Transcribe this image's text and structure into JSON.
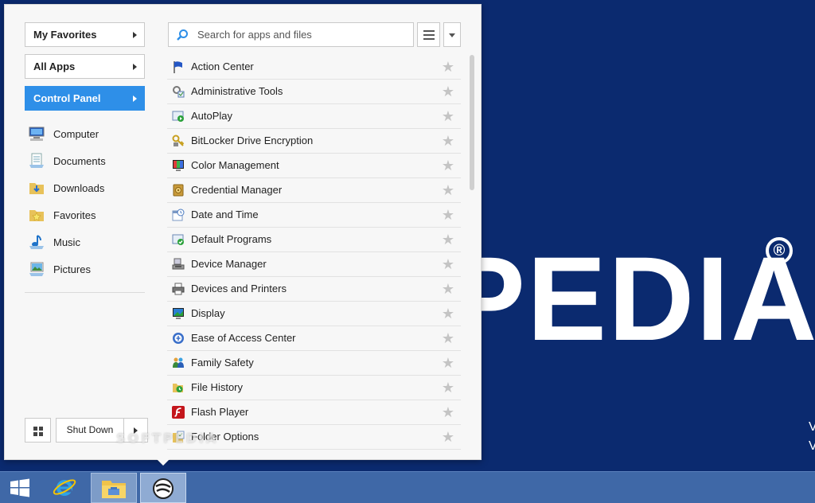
{
  "wallpaper": {
    "text": "PEDIA",
    "registered": "®",
    "fragment_1": "V",
    "fragment_2": "V"
  },
  "start_menu": {
    "nav_buttons": [
      {
        "label": "My Favorites",
        "active": false
      },
      {
        "label": "All Apps",
        "active": false
      },
      {
        "label": "Control Panel",
        "active": true
      }
    ],
    "places": [
      {
        "label": "Computer",
        "icon": "computer-icon"
      },
      {
        "label": "Documents",
        "icon": "documents-icon"
      },
      {
        "label": "Downloads",
        "icon": "downloads-icon"
      },
      {
        "label": "Favorites",
        "icon": "favorites-icon"
      },
      {
        "label": "Music",
        "icon": "music-icon"
      },
      {
        "label": "Pictures",
        "icon": "pictures-icon"
      }
    ],
    "search": {
      "placeholder": "Search for apps and files",
      "value": ""
    },
    "shutdown_label": "Shut Down",
    "apps": [
      {
        "label": "Action Center",
        "icon": "flag-icon",
        "favorite": false
      },
      {
        "label": "Administrative Tools",
        "icon": "admin-tools-icon",
        "favorite": false
      },
      {
        "label": "AutoPlay",
        "icon": "autoplay-icon",
        "favorite": false
      },
      {
        "label": "BitLocker Drive Encryption",
        "icon": "bitlocker-icon",
        "favorite": false
      },
      {
        "label": "Color Management",
        "icon": "color-management-icon",
        "favorite": false
      },
      {
        "label": "Credential Manager",
        "icon": "credential-manager-icon",
        "favorite": false
      },
      {
        "label": "Date and Time",
        "icon": "date-time-icon",
        "favorite": false
      },
      {
        "label": "Default Programs",
        "icon": "default-programs-icon",
        "favorite": false
      },
      {
        "label": "Device Manager",
        "icon": "device-manager-icon",
        "favorite": false
      },
      {
        "label": "Devices and Printers",
        "icon": "printer-icon",
        "favorite": false
      },
      {
        "label": "Display",
        "icon": "display-icon",
        "favorite": false
      },
      {
        "label": "Ease of Access Center",
        "icon": "ease-of-access-icon",
        "favorite": false
      },
      {
        "label": "Family Safety",
        "icon": "family-safety-icon",
        "favorite": false
      },
      {
        "label": "File History",
        "icon": "file-history-icon",
        "favorite": false
      },
      {
        "label": "Flash Player",
        "icon": "flash-player-icon",
        "favorite": false
      },
      {
        "label": "Folder Options",
        "icon": "folder-options-icon",
        "favorite": false
      }
    ]
  },
  "watermark": "SOFTPEDIA",
  "taskbar": {
    "items": [
      {
        "name": "windows-start-icon"
      },
      {
        "name": "internet-explorer-icon"
      },
      {
        "name": "file-explorer-icon"
      },
      {
        "name": "start-menu-app-icon"
      }
    ]
  },
  "colors": {
    "accent": "#2e8fe8",
    "desktop": "#0b2a6f",
    "taskbar": "#3f68a7"
  }
}
